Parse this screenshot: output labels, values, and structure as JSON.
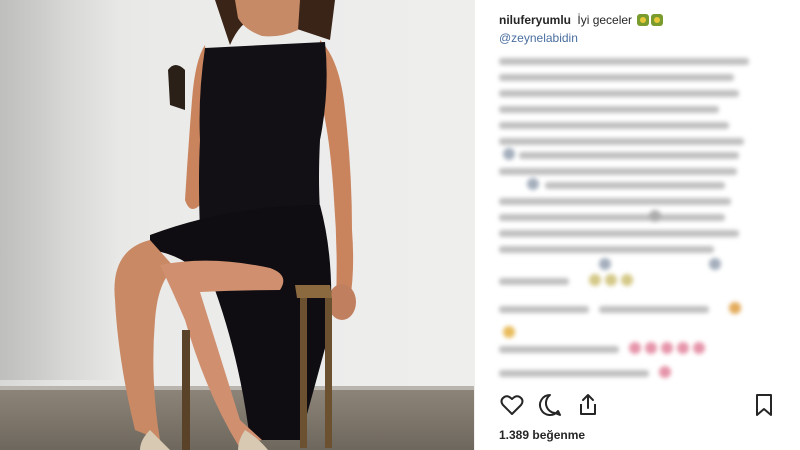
{
  "post": {
    "username": "niluferyumlu",
    "caption": "İyi geceler",
    "caption_emojis": [
      "four-leaf-clover-emoji",
      "four-leaf-clover-emoji"
    ],
    "mention": "@zeynelabidin",
    "likes_text": "1.389 beğenme"
  },
  "comments_blurred": true,
  "actions": {
    "icons": [
      "heart-icon",
      "comment-icon",
      "share-icon",
      "bookmark-icon"
    ]
  },
  "colors": {
    "text": "#262626",
    "mention": "#4a6fa0",
    "emoji_green": "#7a9b2e",
    "divider": "#efefef"
  }
}
